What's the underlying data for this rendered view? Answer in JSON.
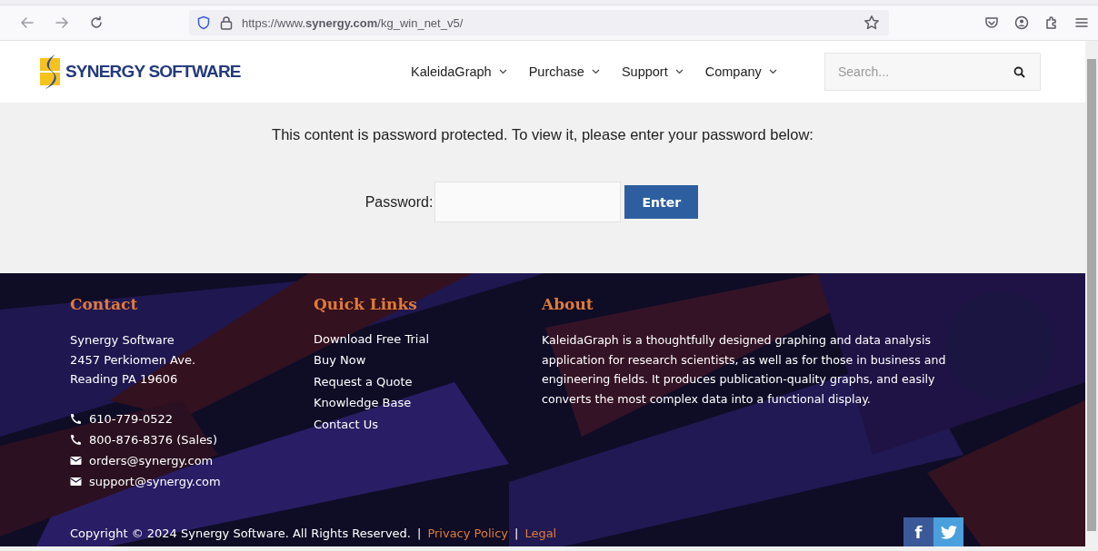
{
  "browser": {
    "url": "https://www.**synergy.com**/kg_win_net_v5/"
  },
  "header": {
    "logo": "SYNERGY SOFTWARE",
    "nav": [
      {
        "label": "KaleidaGraph"
      },
      {
        "label": "Purchase"
      },
      {
        "label": "Support"
      },
      {
        "label": "Company"
      }
    ],
    "search": {
      "placeholder": "Search..."
    }
  },
  "protected": {
    "message": "This content is password protected. To view it, please enter your password below:",
    "password_label": "Password:",
    "button": "Enter"
  },
  "footer": {
    "contact": {
      "heading": "Contact",
      "address": [
        "Synergy Software",
        "2457 Perkiomen Ave.",
        "Reading PA 19606"
      ],
      "items": [
        {
          "kind": "phone",
          "text": "610-779-0522"
        },
        {
          "kind": "phone",
          "text": "800-876-8376 (Sales)"
        },
        {
          "kind": "email",
          "text": "orders@synergy.com"
        },
        {
          "kind": "email",
          "text": "support@synergy.com"
        }
      ]
    },
    "quick_links": {
      "heading": "Quick Links",
      "links": [
        "Download Free Trial",
        "Buy Now",
        "Request a Quote",
        "Knowledge Base",
        "Contact Us"
      ]
    },
    "about": {
      "heading": "About",
      "text": "KaleidaGraph is a thoughtfully designed graphing and data analysis application for research scientists, as well as for those in business and engineering fields. It produces publication-quality graphs, and easily converts the most complex data into a functional display."
    },
    "bottom": [
      {
        "kind": "text",
        "text": "Copyright © 2024 Synergy Software. All Rights Reserved."
      },
      {
        "kind": "separator",
        "text": "|"
      },
      {
        "kind": "link",
        "text": "Privacy Policy"
      },
      {
        "kind": "separator",
        "text": "|"
      },
      {
        "kind": "link",
        "text": "Legal"
      }
    ],
    "social": [
      {
        "kind": "facebook",
        "glyph": "f"
      },
      {
        "kind": "twitter"
      }
    ]
  }
}
